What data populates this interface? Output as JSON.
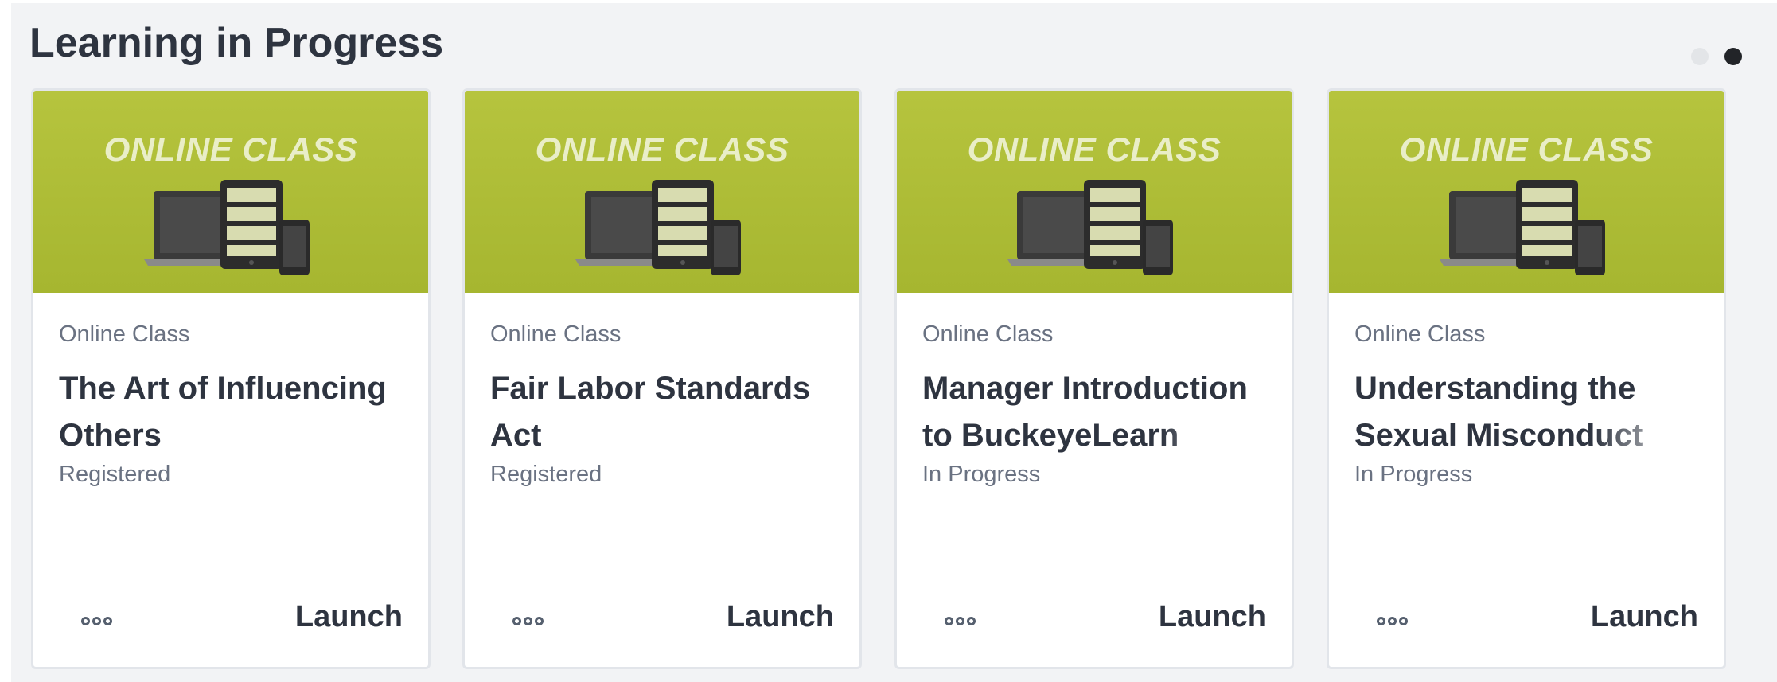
{
  "section": {
    "title": "Learning in Progress",
    "pager": {
      "pages": 2,
      "active_page": 2
    }
  },
  "cards": [
    {
      "hero_label": "ONLINE CLASS",
      "type": "Online Class",
      "title": "The Art of Influencing Others",
      "status": "Registered",
      "menu_icon": "more-icon",
      "launch_label": "Launch"
    },
    {
      "hero_label": "ONLINE CLASS",
      "type": "Online Class",
      "title": "Fair Labor Standards Act",
      "status": "Registered",
      "menu_icon": "more-icon",
      "launch_label": "Launch"
    },
    {
      "hero_label": "ONLINE CLASS",
      "type": "Online Class",
      "title": "Manager Introduction to BuckeyeLearn",
      "status": "In Progress",
      "menu_icon": "more-icon",
      "launch_label": "Launch"
    },
    {
      "hero_label": "ONLINE CLASS",
      "type": "Online Class",
      "title": "Understanding the Sexual Misconduct",
      "status": "In Progress",
      "menu_icon": "more-icon",
      "launch_label": "Launch"
    }
  ],
  "colors": {
    "hero_green": "#b1c038",
    "title_text": "#2e3440",
    "muted_text": "#6a7282",
    "panel_bg": "#f2f3f5"
  }
}
